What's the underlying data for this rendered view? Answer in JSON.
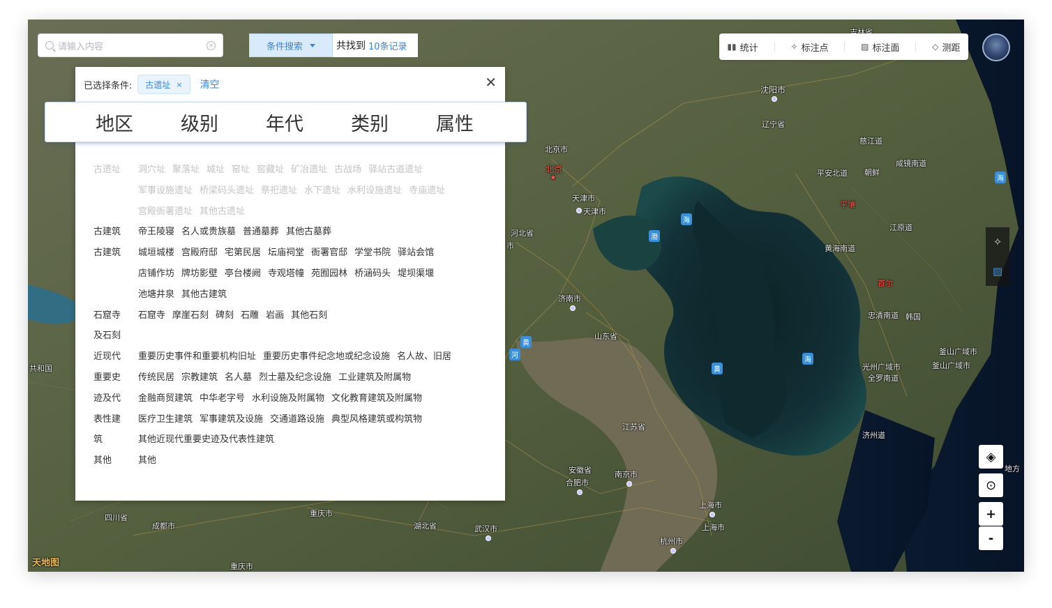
{
  "search": {
    "placeholder": "请输入内容"
  },
  "condition": {
    "button_label": "条件搜索",
    "found_prefix": "共找到",
    "found_count": "10条记录"
  },
  "toolbar": {
    "stats": "统计",
    "mark_point": "标注点",
    "mark_area": "标注面",
    "measure": "测距"
  },
  "panel": {
    "selected_label": "已选择条件:",
    "chip": "古遗址",
    "chip_remove": "×",
    "clear": "清空",
    "close": "✕",
    "tabs": [
      "地区",
      "级别",
      "年代",
      "类别",
      "属性"
    ],
    "rows": [
      {
        "category": "古遗址",
        "items": [
          "洞穴址",
          "聚落址",
          "城址",
          "窑址",
          "窖藏址",
          "矿冶遗址",
          "古战场",
          "驿站古道遗址"
        ]
      },
      {
        "category": "",
        "items": [
          "军事设施遗址",
          "桥梁码头遗址",
          "祭祀遗址",
          "水下遗址",
          "水利设施遗址",
          "寺庙遗址"
        ]
      },
      {
        "category": "",
        "items": [
          "宫殿衙署遗址",
          "其他古遗址"
        ]
      },
      {
        "category": "古建筑",
        "items": [
          "帝王陵寝",
          "名人或贵族墓",
          "普通墓葬",
          "其他古墓葬"
        ]
      },
      {
        "category": "古建筑",
        "items": [
          "城垣城楼",
          "宫殿府邸",
          "宅第民居",
          "坛庙祠堂",
          "衙署官邸",
          "学堂书院",
          "驿站会馆"
        ]
      },
      {
        "category": "",
        "items": [
          "店铺作坊",
          "牌坊影壁",
          "亭台楼阙",
          "寺观塔幢",
          "苑囿园林",
          "桥涵码头",
          "堤坝渠堰"
        ]
      },
      {
        "category": "",
        "items": [
          "池塘井泉",
          "其他古建筑"
        ]
      },
      {
        "category": "石窟寺",
        "items": [
          "石窟寺",
          "摩崖石刻",
          "碑刻",
          "石雕",
          "岩画",
          "其他石刻"
        ]
      },
      {
        "category": "及石刻",
        "items": []
      },
      {
        "category": "近现代",
        "items": [
          "重要历史事件和重要机构旧址",
          "重要历史事件纪念地或纪念设施",
          "名人故、旧居"
        ]
      },
      {
        "category": "重要史",
        "items": [
          "传统民居",
          "宗教建筑",
          "名人墓",
          "烈士墓及纪念设施",
          "工业建筑及附属物"
        ]
      },
      {
        "category": "迹及代",
        "items": [
          "金融商贸建筑",
          "中华老字号",
          "水利设施及附属物",
          "文化教育建筑及附属物"
        ]
      },
      {
        "category": "表性建",
        "items": [
          "医疗卫生建筑",
          "军事建筑及设施",
          "交通道路设施",
          "典型风格建筑或构筑物"
        ]
      },
      {
        "category": "筑",
        "items": [
          "其他近现代重要史迹及代表性建筑"
        ]
      },
      {
        "category": "其他",
        "items": [
          "其他"
        ]
      }
    ]
  },
  "map": {
    "labels": {
      "shenyang": "沈阳市",
      "liaoning": "辽宁省",
      "beijing_city": "北京市",
      "beijing": "北京",
      "tianjin_city": "天津市",
      "tianjin": "天津市",
      "hebei": "河北省",
      "jinan": "济南市",
      "shandong": "山东省",
      "jiangsu": "江苏省",
      "anhui": "安徽省",
      "hefei": "合肥市",
      "nanjing": "南京市",
      "shanghai_a": "上海市",
      "shanghai_b": "上海市",
      "hangzhou": "杭州市",
      "wuhan": "武汉市",
      "hubei": "湖北省",
      "chongqing": "重庆市",
      "chongqing2": "重庆市",
      "chengdu": "成都市",
      "sichuan": "四川省",
      "pyongan": "平安北道",
      "korea": "朝鲜",
      "cigang": "慈江道",
      "xianjing": "咸镜南道",
      "pyongyang": "平壤",
      "huanghai": "黄海南道",
      "jiangyuan": "江原道",
      "seoul": "首尔",
      "zhongqing": "忠清南道",
      "rok": "韩国",
      "busan_area": "釜山广域市",
      "busan": "釜山广域市",
      "gwangju": "光州广域市",
      "jeolla": "全罗南道",
      "jeju": "济州道",
      "gonghe": "共和国",
      "jilin": "吉林省",
      "hai1": "海",
      "hai2": "海",
      "hai3": "海",
      "huang": "黄",
      "huang2": "黄",
      "he": "河",
      "bo": "渤",
      "shi": "市",
      "dongfang": "地方",
      "logo": "天地图"
    },
    "colors": {
      "accent": "#3a86d6",
      "sea": "#0e2d33",
      "land": "#4e5a3e"
    }
  },
  "icons": {
    "search": "search-icon",
    "clear": "clear-icon",
    "caret": "caret-down-icon",
    "stats": "bar-chart-icon",
    "pin": "pin-icon",
    "area": "hatched-area-icon",
    "ruler": "ruler-icon",
    "layers": "layers-icon",
    "locate": "locate-icon",
    "zoom_in": "+",
    "zoom_out": "-"
  }
}
